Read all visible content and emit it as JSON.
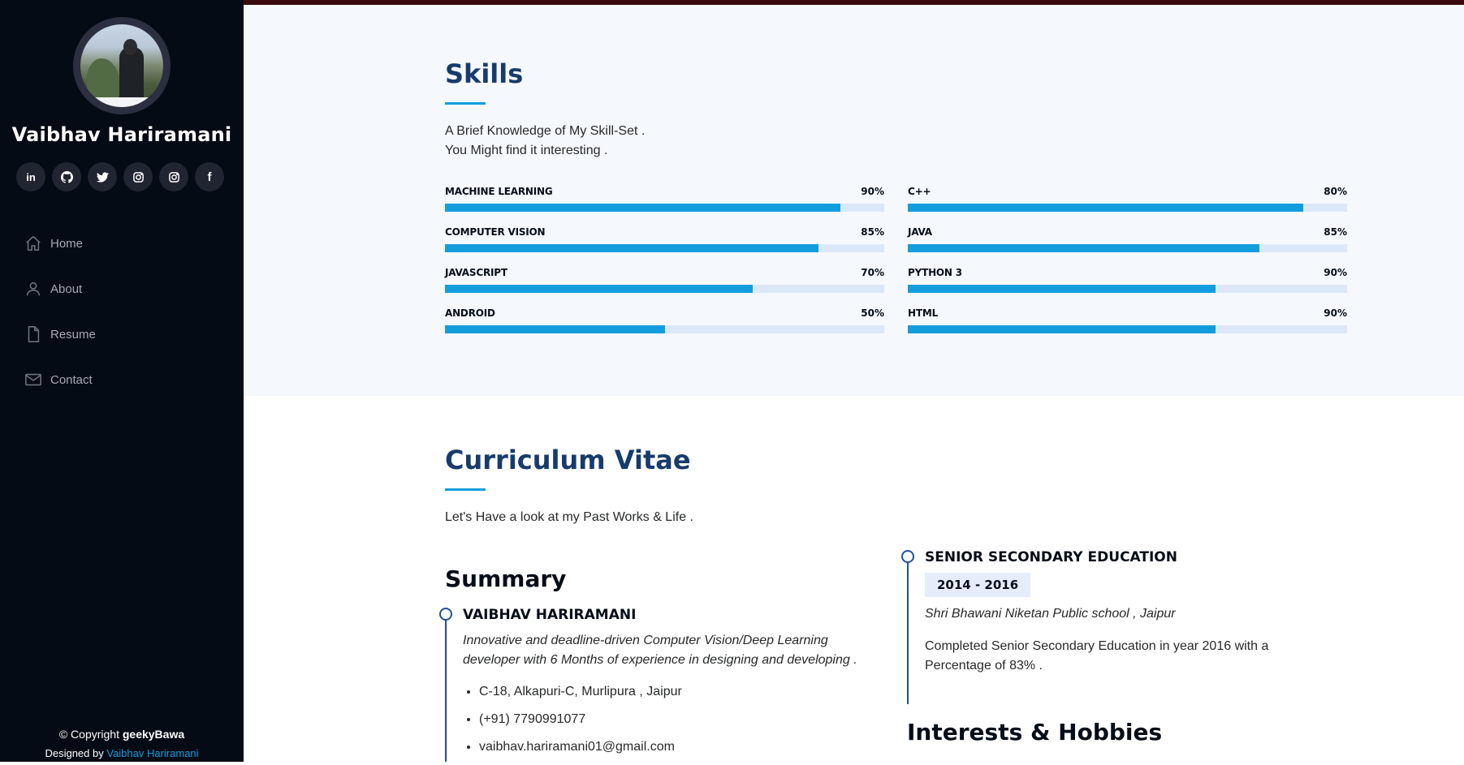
{
  "profile": {
    "name": "Vaibhav Hariramani"
  },
  "socials": [
    {
      "name": "linkedin-icon",
      "glyph": "in"
    },
    {
      "name": "github-icon"
    },
    {
      "name": "twitter-icon"
    },
    {
      "name": "instagram-icon"
    },
    {
      "name": "instagram-icon"
    },
    {
      "name": "facebook-icon",
      "glyph": "f"
    }
  ],
  "nav": {
    "items": [
      {
        "label": "Home",
        "icon": "home-icon"
      },
      {
        "label": "About",
        "icon": "person-icon"
      },
      {
        "label": "Resume",
        "icon": "file-icon"
      },
      {
        "label": "Contact",
        "icon": "envelope-icon"
      }
    ]
  },
  "footer": {
    "copyright_prefix": "© Copyright ",
    "copyright_brand": "geekyBawa",
    "designed_prefix": "Designed by ",
    "designed_by": "Vaibhav Hariramani"
  },
  "skills": {
    "title": "Skills",
    "intro_line1": "A Brief Knowledge of My Skill-Set .",
    "intro_line2": "You Might find it interesting .",
    "left": [
      {
        "label": "MACHINE LEARNING",
        "pct_text": "90%",
        "fill": 0.9
      },
      {
        "label": "COMPUTER VISION",
        "pct_text": "85%",
        "fill": 0.85
      },
      {
        "label": "JAVASCRIPT",
        "pct_text": "70%",
        "fill": 0.7
      },
      {
        "label": "ANDROID",
        "pct_text": "50%",
        "fill": 0.5
      }
    ],
    "right": [
      {
        "label": "C++",
        "pct_text": "80%",
        "fill": 0.9
      },
      {
        "label": "JAVA",
        "pct_text": "85%",
        "fill": 0.8
      },
      {
        "label": "PYTHON 3",
        "pct_text": "90%",
        "fill": 0.7
      },
      {
        "label": "HTML",
        "pct_text": "90%",
        "fill": 0.7
      }
    ],
    "colors": {
      "fill": "#149ddd",
      "track": "#dce8f8"
    }
  },
  "resume": {
    "title": "Curriculum Vitae",
    "intro": "Let's Have a look at my Past Works & Life .",
    "summary": {
      "heading": "Summary",
      "name": "VAIBHAV HARIRAMANI",
      "desc_line1": "Innovative and deadline-driven Computer Vision/Deep Learning",
      "desc_line2": "developer with 6 Months of experience in designing and developing .",
      "contacts": [
        "C-18, Alkapuri-C, Murlipura , Jaipur",
        "(+91) 7790991077",
        "vaibhav.hariramani01@gmail.com"
      ]
    },
    "education": {
      "heading": "SENIOR SECONDARY EDUCATION",
      "period": "2014 - 2016",
      "school": "Shri Bhawani Niketan Public school , Jaipur",
      "desc_line1": "Completed Senior Secondary Education in year 2016 with a",
      "desc_line2": "Percentage of 83% ."
    },
    "interests_heading": "Interests & Hobbies"
  }
}
